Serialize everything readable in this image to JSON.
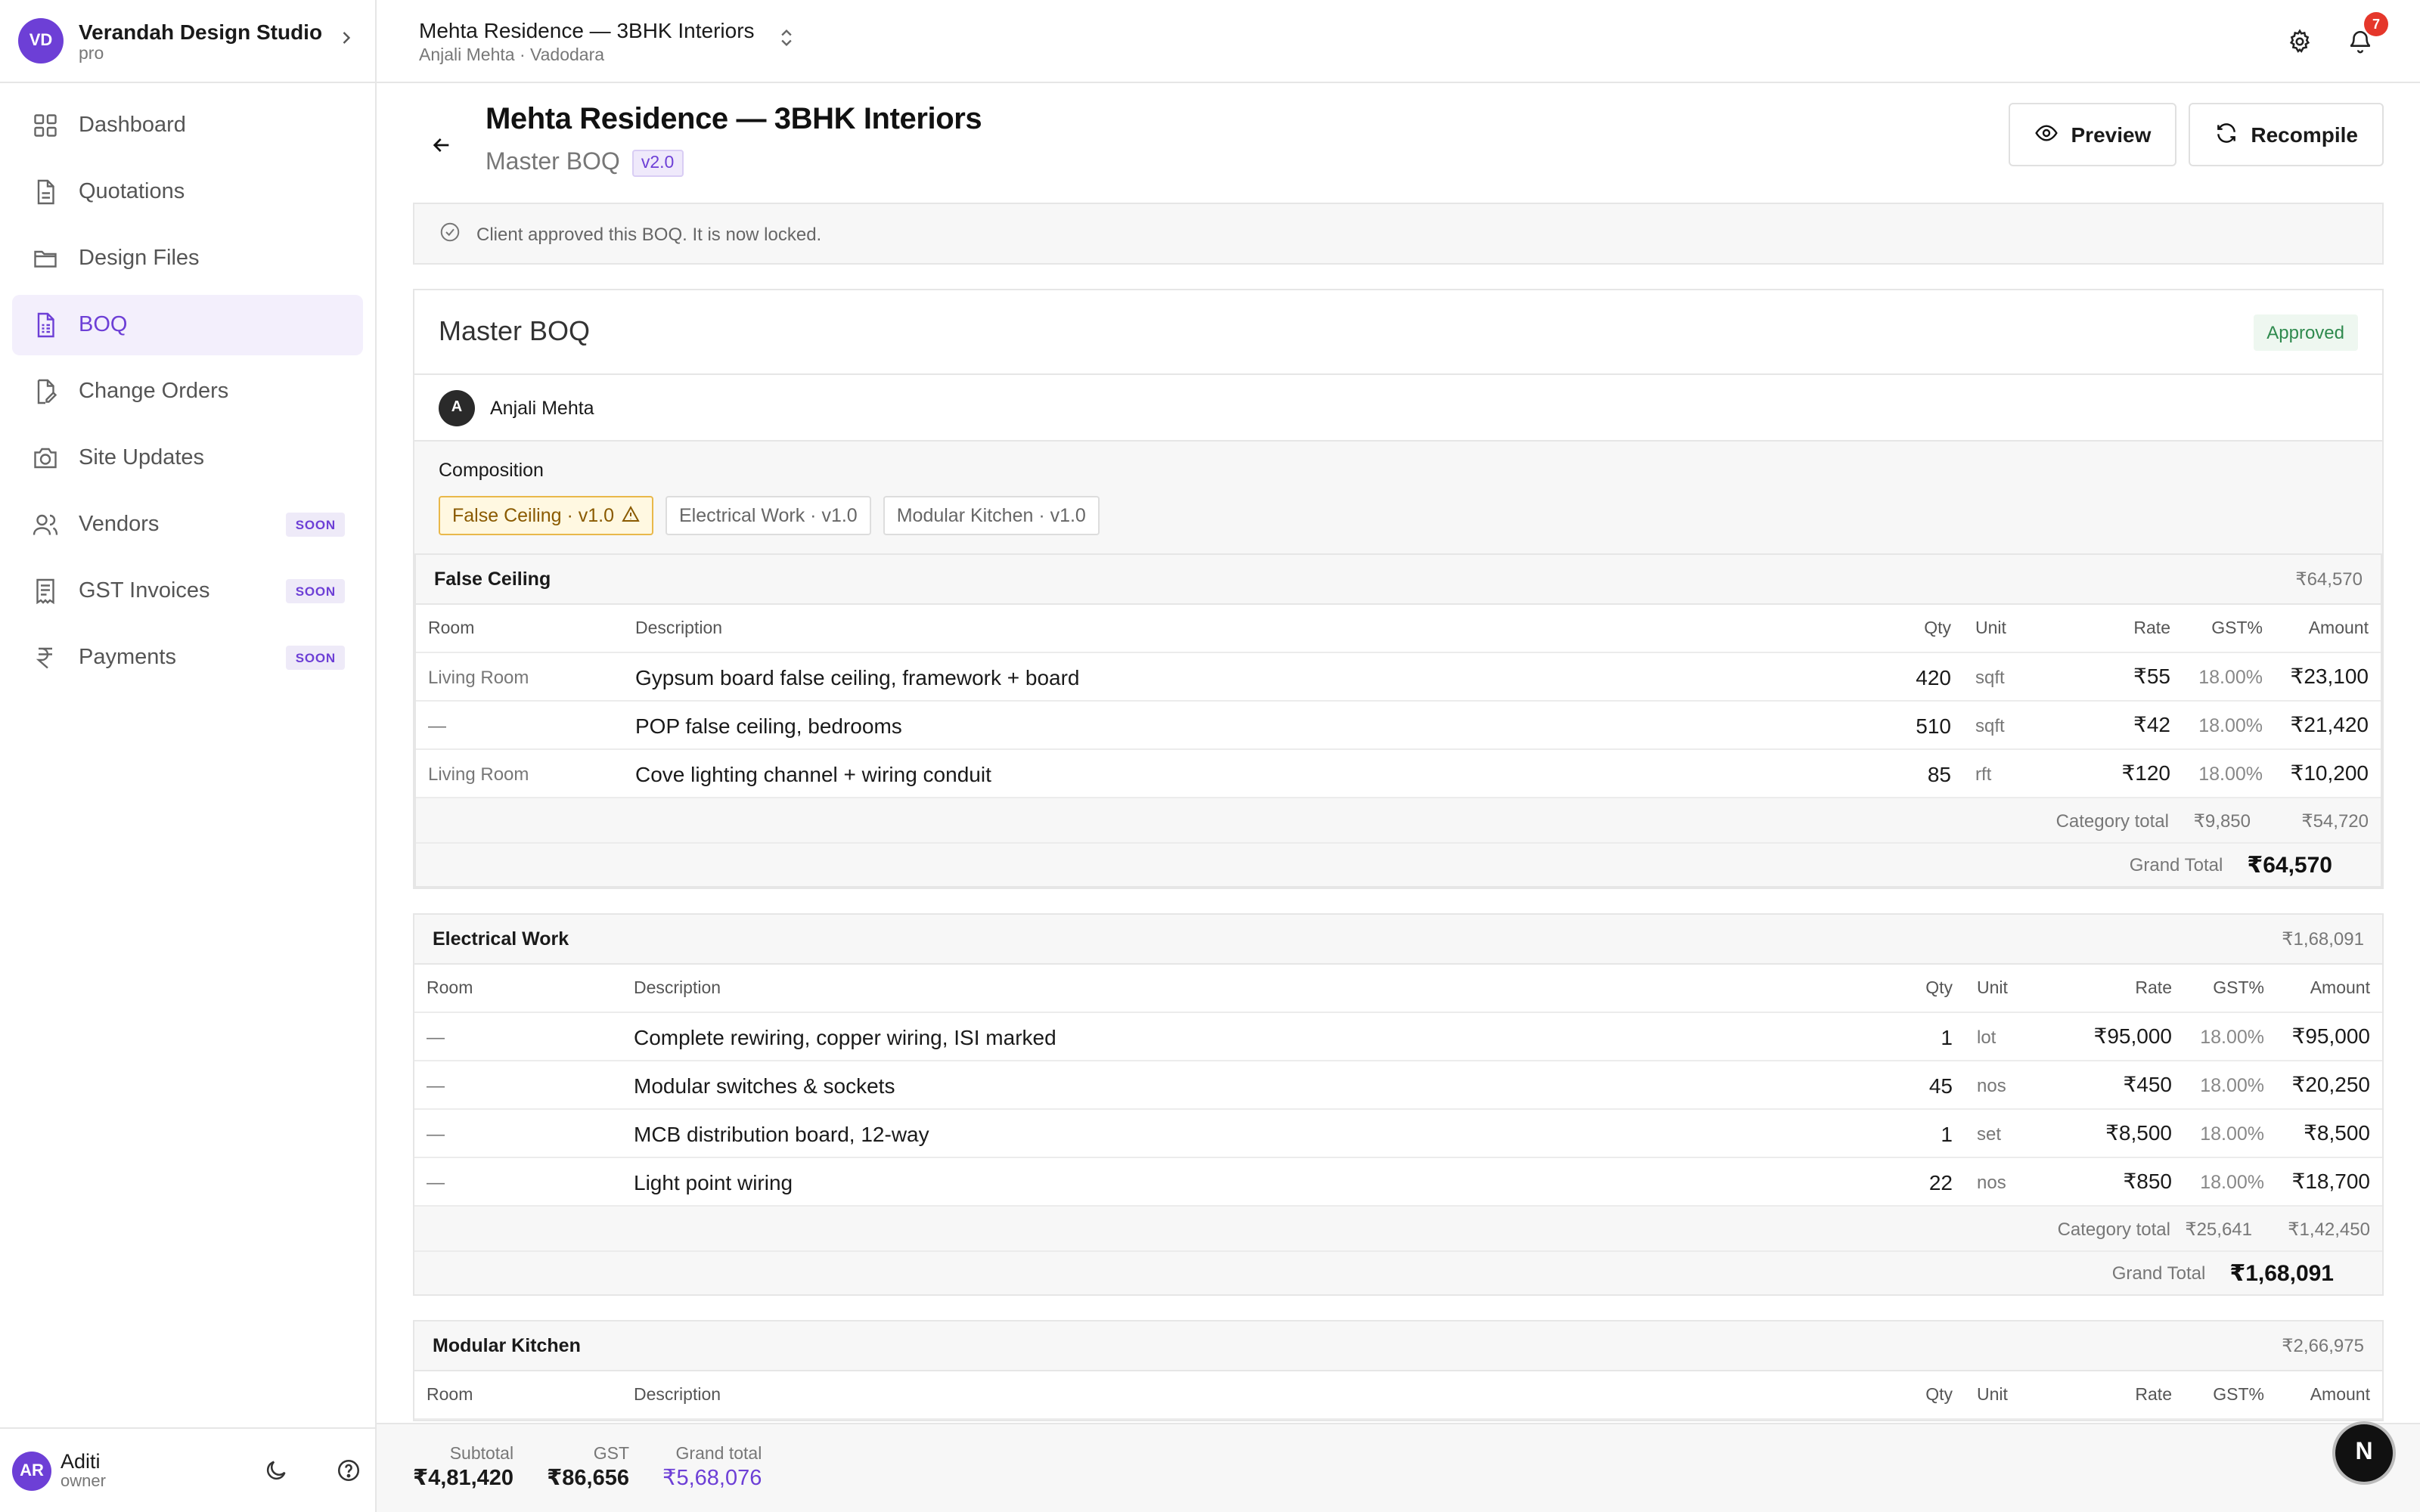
{
  "workspace": {
    "initials": "VD",
    "name": "Verandah Design Studio",
    "plan": "pro"
  },
  "nav": [
    {
      "label": "Dashboard",
      "icon": "dashboard-icon",
      "soon": ""
    },
    {
      "label": "Quotations",
      "icon": "document-icon",
      "soon": ""
    },
    {
      "label": "Design Files",
      "icon": "folder-icon",
      "soon": ""
    },
    {
      "label": "BOQ",
      "icon": "spreadsheet-icon",
      "soon": "",
      "active": true
    },
    {
      "label": "Change Orders",
      "icon": "edit-document-icon",
      "soon": ""
    },
    {
      "label": "Site Updates",
      "icon": "camera-icon",
      "soon": ""
    },
    {
      "label": "Vendors",
      "icon": "users-icon",
      "soon": "SOON"
    },
    {
      "label": "GST Invoices",
      "icon": "receipt-icon",
      "soon": "SOON"
    },
    {
      "label": "Payments",
      "icon": "rupee-icon",
      "soon": "SOON"
    }
  ],
  "user": {
    "initials": "AR",
    "name": "Aditi",
    "role": "owner"
  },
  "project": {
    "title": "Mehta Residence — 3BHK Interiors",
    "subtitle": "Anjali Mehta · Vadodara"
  },
  "notifications": {
    "count": "7"
  },
  "page": {
    "title": "Mehta Residence — 3BHK Interiors",
    "subtitle": "Master BOQ",
    "version": "v2.0",
    "preview_label": "Preview",
    "recompile_label": "Recompile",
    "alert": "Client approved this BOQ. It is now locked."
  },
  "boq": {
    "title": "Master BOQ",
    "status": "Approved",
    "author_initial": "A",
    "author": "Anjali Mehta",
    "composition_label": "Composition",
    "chips": [
      "False Ceiling · v1.0",
      "Electrical Work · v1.0",
      "Modular Kitchen · v1.0"
    ]
  },
  "columns": {
    "room": "Room",
    "description": "Description",
    "qty": "Qty",
    "unit": "Unit",
    "rate": "Rate",
    "gst": "GST%",
    "amount": "Amount"
  },
  "sections": [
    {
      "name": "False Ceiling",
      "total": "₹64,570",
      "rows": [
        {
          "room": "Living Room",
          "description": "Gypsum board false ceiling, framework + board",
          "qty": "420",
          "unit": "sqft",
          "rate": "₹55",
          "gst": "18.00%",
          "amount": "₹23,100"
        },
        {
          "room": "—",
          "description": "POP false ceiling, bedrooms",
          "qty": "510",
          "unit": "sqft",
          "rate": "₹42",
          "gst": "18.00%",
          "amount": "₹21,420"
        },
        {
          "room": "Living Room",
          "description": "Cove lighting channel + wiring conduit",
          "qty": "85",
          "unit": "rft",
          "rate": "₹120",
          "gst": "18.00%",
          "amount": "₹10,200"
        }
      ],
      "category_total_label": "Category total",
      "category_gst": "₹9,850",
      "category_amount": "₹54,720",
      "grand_total_label": "Grand Total",
      "grand_total": "₹64,570"
    },
    {
      "name": "Electrical Work",
      "total": "₹1,68,091",
      "rows": [
        {
          "room": "—",
          "description": "Complete rewiring, copper wiring, ISI marked",
          "qty": "1",
          "unit": "lot",
          "rate": "₹95,000",
          "gst": "18.00%",
          "amount": "₹95,000"
        },
        {
          "room": "—",
          "description": "Modular switches & sockets",
          "qty": "45",
          "unit": "nos",
          "rate": "₹450",
          "gst": "18.00%",
          "amount": "₹20,250"
        },
        {
          "room": "—",
          "description": "MCB distribution board, 12-way",
          "qty": "1",
          "unit": "set",
          "rate": "₹8,500",
          "gst": "18.00%",
          "amount": "₹8,500"
        },
        {
          "room": "—",
          "description": "Light point wiring",
          "qty": "22",
          "unit": "nos",
          "rate": "₹850",
          "gst": "18.00%",
          "amount": "₹18,700"
        }
      ],
      "category_total_label": "Category total",
      "category_gst": "₹25,641",
      "category_amount": "₹1,42,450",
      "grand_total_label": "Grand Total",
      "grand_total": "₹1,68,091"
    },
    {
      "name": "Modular Kitchen",
      "total": "₹2,66,975"
    }
  ],
  "summary": {
    "subtotal_label": "Subtotal",
    "subtotal": "₹4,81,420",
    "gst_label": "GST",
    "gst": "₹86,656",
    "grand_label": "Grand total",
    "grand": "₹5,68,076"
  },
  "fab_label": "N"
}
